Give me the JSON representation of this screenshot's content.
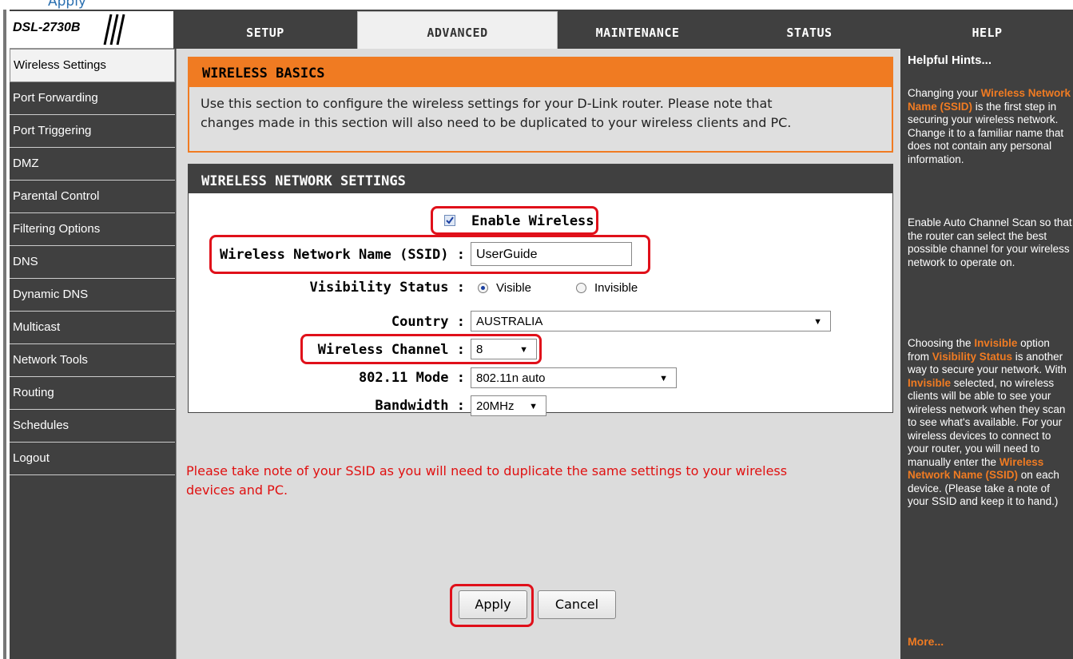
{
  "page_top_fragment": "Apply",
  "header": {
    "model": "DSL-2730B",
    "tabs": [
      {
        "label": "SETUP"
      },
      {
        "label": "ADVANCED"
      },
      {
        "label": "MAINTENANCE"
      },
      {
        "label": "STATUS"
      },
      {
        "label": "HELP"
      }
    ]
  },
  "sidebar": {
    "items": [
      {
        "label": "Wireless Settings"
      },
      {
        "label": "Port Forwarding"
      },
      {
        "label": "Port Triggering"
      },
      {
        "label": "DMZ"
      },
      {
        "label": "Parental Control"
      },
      {
        "label": "Filtering Options"
      },
      {
        "label": "DNS"
      },
      {
        "label": "Dynamic DNS"
      },
      {
        "label": "Multicast"
      },
      {
        "label": "Network Tools"
      },
      {
        "label": "Routing"
      },
      {
        "label": "Schedules"
      },
      {
        "label": "Logout"
      }
    ]
  },
  "basics": {
    "title": "WIRELESS BASICS",
    "desc_line1": "Use this section to configure the wireless settings for your D-Link router. Please note that",
    "desc_line2": "changes made in this section will also need to be duplicated to your wireless clients and PC."
  },
  "wns": {
    "title": "WIRELESS NETWORK SETTINGS",
    "enable_label": "Enable Wireless",
    "enable_checked": true,
    "ssid_label": "Wireless Network Name (SSID) :",
    "ssid_value": "UserGuide",
    "visibility_label": "Visibility Status :",
    "visibility_opt1": "Visible",
    "visibility_opt2": "Invisible",
    "visibility_selected": "Visible",
    "country_label": "Country :",
    "country_value": "AUSTRALIA",
    "channel_label": "Wireless Channel :",
    "channel_value": "8",
    "mode_label": "802.11 Mode :",
    "mode_value": "802.11n auto",
    "bandwidth_label": "Bandwidth :",
    "bandwidth_value": "20MHz"
  },
  "note": {
    "line1": "Please take note of your SSID as you will need to duplicate the same settings to your wireless",
    "line2": "devices and PC."
  },
  "buttons": {
    "apply": "Apply",
    "cancel": "Cancel"
  },
  "help": {
    "title": "Helpful Hints...",
    "p1_a": "Changing your ",
    "p1_b": "Wireless Network Name (SSID)",
    "p1_c": " is the first step in securing your wireless network. Change it to a familiar name that does not contain any personal information.",
    "p2": "Enable Auto Channel Scan so that the router can select the best possible channel for your wireless network to operate on.",
    "p3_a": "Choosing the ",
    "p3_b": "Invisible",
    "p3_c": " option from ",
    "p3_d": "Visibility Status",
    "p3_e": " is another way to secure your network. With ",
    "p3_f": "Invisible",
    "p3_g": " selected, no wireless clients will be able to see your wireless network when they scan to see what's available. For your wireless devices to connect to your router, you will need to manually enter the ",
    "p3_h": "Wireless Network Name (SSID)",
    "p3_i": " on each device. (Please take a note of your SSID and keep it to hand.)",
    "more": "More..."
  },
  "colors": {
    "accent_orange": "#f07b22",
    "header_gray": "#404040",
    "highlight_red": "#e0101a"
  }
}
